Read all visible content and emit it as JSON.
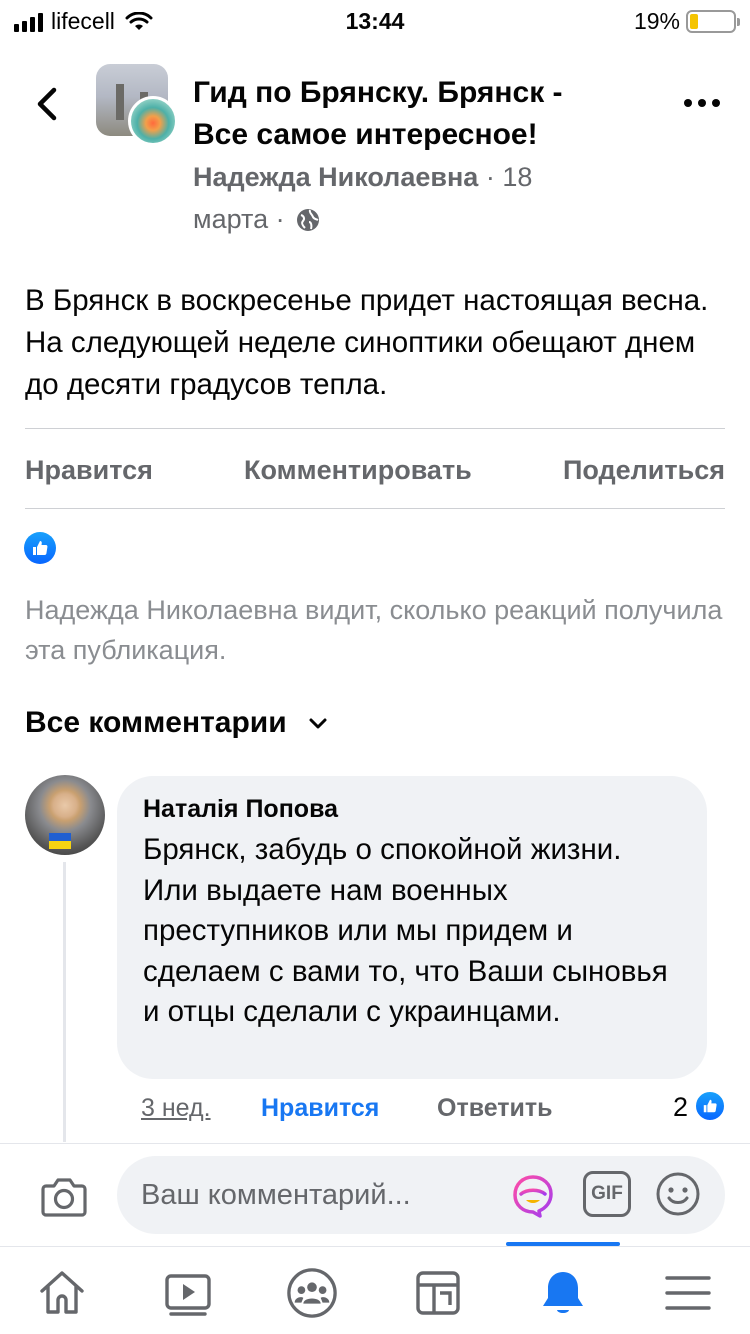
{
  "status_bar": {
    "carrier": "lifecell",
    "time": "13:44",
    "battery_percent": "19%",
    "battery_level": 0.19
  },
  "post": {
    "group_name": "Гид по Брянску. Брянск - Все самое интересное!",
    "author": "Надежда Николаевна",
    "separator": "·",
    "date": "18 марта",
    "privacy_icon": "globe-icon",
    "text": "В Брянск в воскресенье придет настоящая весна. На следующей неделе синоптики обещают днем до десяти градусов тепла.",
    "actions": {
      "like": "Нравится",
      "comment": "Комментировать",
      "share": "Поделиться"
    },
    "reactions_note": "Надежда Николаевна видит, сколько реакций получила эта публикация."
  },
  "comments_section": {
    "header": "Все комментарии",
    "comments": [
      {
        "author": "Наталія Попова",
        "text": "Брянск, забудь о спокойной жизни. Или выдаете нам военных преступников или мы придем и сделаем с вами то, что Ваши сыновья и отцы сделали с украинцами.",
        "time": "3 нед.",
        "like_label": "Нравится",
        "reply_label": "Ответить",
        "reaction_count": "2"
      }
    ]
  },
  "compose": {
    "placeholder": "Ваш комментарий...",
    "gif_label": "GIF"
  },
  "tab_bar": {
    "items": [
      "home-icon",
      "video-icon",
      "groups-icon",
      "feeds-icon",
      "notifications-icon",
      "menu-icon"
    ],
    "active": "notifications-icon"
  },
  "colors": {
    "accent": "#1877f2",
    "secondary_text": "#65676b",
    "bubble": "#f0f2f5"
  }
}
